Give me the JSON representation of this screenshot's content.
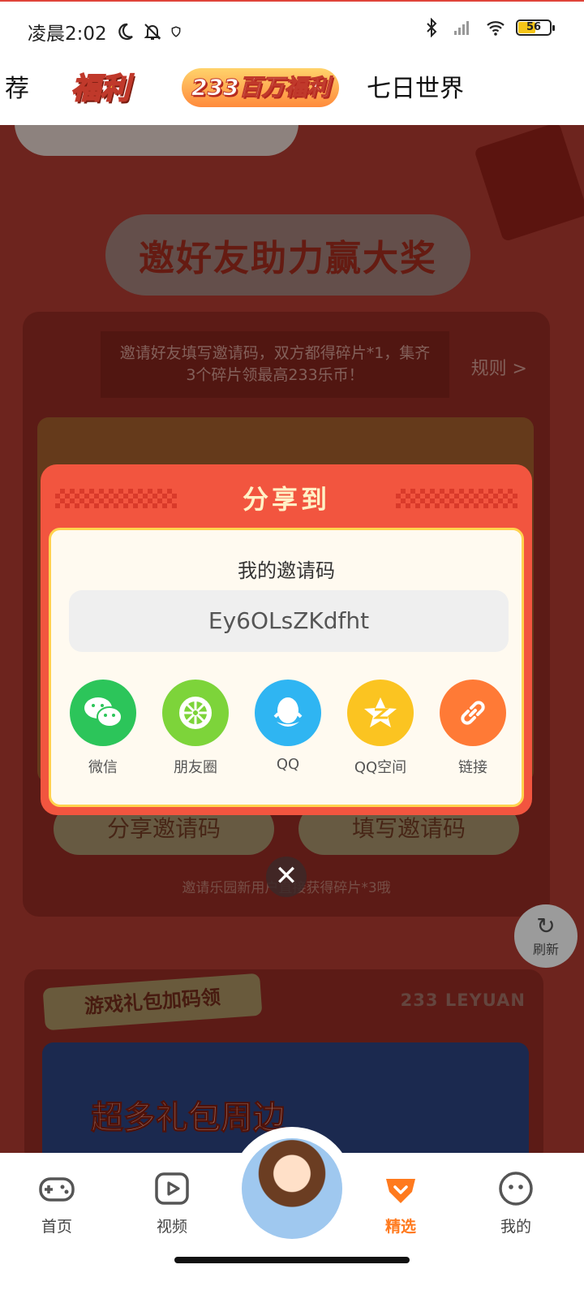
{
  "status_bar": {
    "time": "凌晨2:02",
    "battery": "56",
    "battery_level": 0.56
  },
  "top_tabs": [
    {
      "label": "荐"
    },
    {
      "label": "福利"
    },
    {
      "label": "233百万福利"
    },
    {
      "label": "七日世界"
    }
  ],
  "background": {
    "banner_title": "邀好友助力赢大奖",
    "invite_desc": "邀请好友填写邀请码，双方都得碎片*1，集齐3个碎片领最高233乐币！",
    "rules_link": "规则 >",
    "share_code_button": "分享邀请码",
    "fill_code_button": "填写邀请码",
    "invite_hint": "邀请乐园新用户直接获得碎片*3哦",
    "refresh_label": "刷新",
    "gift_tag": "游戏礼包加码领",
    "leyuan_brand": "233 LEYUAN",
    "game_banner_text": "超多礼包周边"
  },
  "share_modal": {
    "title": "分享到",
    "code_label": "我的邀请码",
    "code_value": "Ey6OLsZKdfht",
    "options": [
      {
        "label": "微信",
        "icon": "wechat-icon",
        "color": "#2cc55a"
      },
      {
        "label": "朋友圈",
        "icon": "moments-icon",
        "color": "#7dd43a"
      },
      {
        "label": "QQ",
        "icon": "qq-icon",
        "color": "#2fb5f2"
      },
      {
        "label": "QQ空间",
        "icon": "qzone-icon",
        "color": "#fbc421"
      },
      {
        "label": "链接",
        "icon": "link-icon",
        "color": "#ff7a36"
      }
    ],
    "close": "✕"
  },
  "bottom_nav": [
    {
      "label": "首页",
      "icon": "gamepad-icon"
    },
    {
      "label": "视频",
      "icon": "video-play-icon"
    },
    {
      "label": "",
      "icon": "avatar"
    },
    {
      "label": "精选",
      "icon": "featured-icon",
      "active": true
    },
    {
      "label": "我的",
      "icon": "profile-face-icon"
    }
  ],
  "colors": {
    "accent": "#ff7a1e",
    "modal_red": "#f2553f",
    "modal_border": "#ffd34e"
  }
}
